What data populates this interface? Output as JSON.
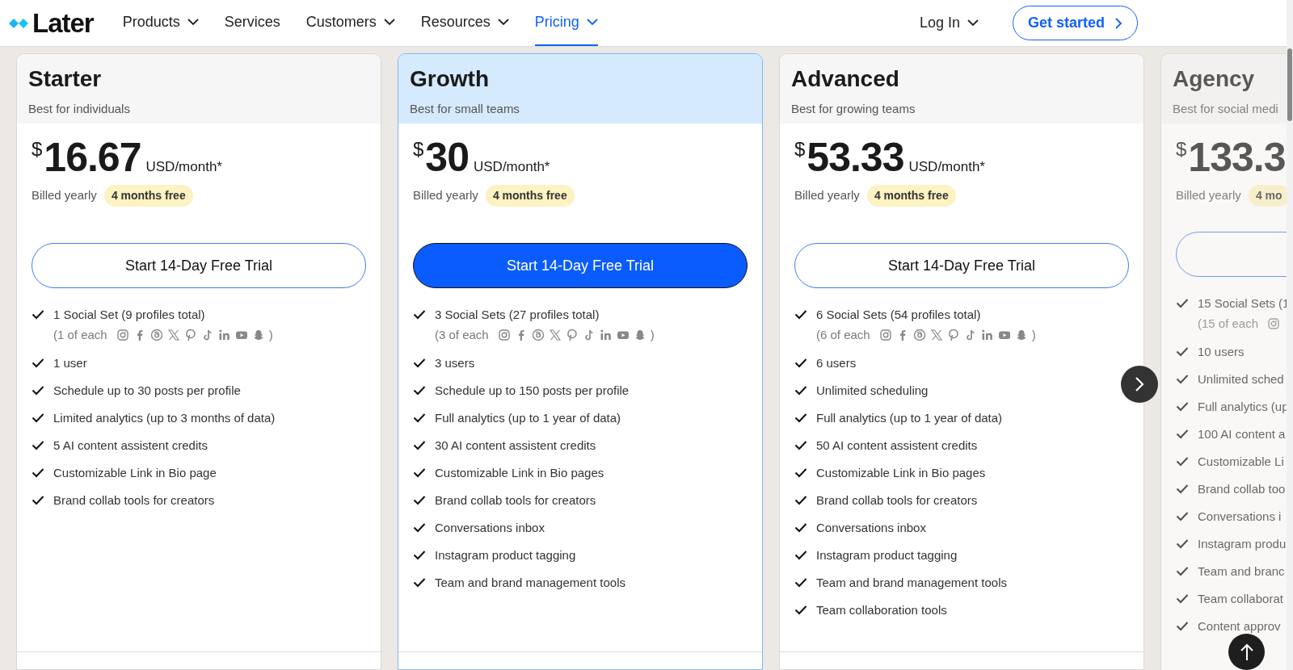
{
  "header": {
    "logo": "Later",
    "nav": [
      {
        "label": "Products",
        "caret": true,
        "selected": false
      },
      {
        "label": "Services",
        "caret": false,
        "selected": false
      },
      {
        "label": "Customers",
        "caret": true,
        "selected": false
      },
      {
        "label": "Resources",
        "caret": true,
        "selected": false
      },
      {
        "label": "Pricing",
        "caret": true,
        "selected": true
      }
    ],
    "login": "Log In",
    "cta": "Get started"
  },
  "plans": [
    {
      "name": "Starter",
      "tagline": "Best for individuals",
      "highlighted": false,
      "dimmed": false,
      "currency": "$",
      "price": "16.67",
      "unit": "USD/month*",
      "billing": "Billed yearly",
      "badge": "4 months free",
      "button": {
        "label": "Start 14-Day Free Trial",
        "kind": "outline"
      },
      "features": [
        {
          "text": "1 Social Set (9 profiles total)",
          "sub": {
            "prefix": "(1 of each",
            "icons": [
              {
                "kind": "instagram"
              },
              {
                "kind": "facebook"
              },
              {
                "kind": "threads"
              },
              {
                "kind": "x"
              },
              {
                "kind": "pinterest"
              },
              {
                "kind": "tiktok"
              },
              {
                "kind": "linkedin"
              },
              {
                "kind": "youtube"
              },
              {
                "kind": "snapchat"
              }
            ],
            "suffix": ")"
          }
        },
        {
          "text": "1 user"
        },
        {
          "text": "Schedule up to 30 posts per profile"
        },
        {
          "text": "Limited analytics (up to 3 months of data)"
        },
        {
          "text": "5 AI content assistent credits"
        },
        {
          "text": "Customizable Link in Bio page"
        },
        {
          "text": "Brand collab tools for creators"
        }
      ]
    },
    {
      "name": "Growth",
      "tagline": "Best for small teams",
      "highlighted": true,
      "dimmed": false,
      "currency": "$",
      "price": "30",
      "unit": "USD/month*",
      "billing": "Billed yearly",
      "badge": "4 months free",
      "button": {
        "label": "Start 14-Day Free Trial",
        "kind": "primary"
      },
      "features": [
        {
          "text": "3 Social Sets (27 profiles total)",
          "sub": {
            "prefix": "(3 of each",
            "icons": [
              {
                "kind": "instagram"
              },
              {
                "kind": "facebook"
              },
              {
                "kind": "threads"
              },
              {
                "kind": "x"
              },
              {
                "kind": "pinterest"
              },
              {
                "kind": "tiktok"
              },
              {
                "kind": "linkedin"
              },
              {
                "kind": "youtube"
              },
              {
                "kind": "snapchat"
              }
            ],
            "suffix": ")"
          }
        },
        {
          "text": "3 users"
        },
        {
          "text": "Schedule up to 150 posts per profile"
        },
        {
          "text": "Full analytics (up to 1 year of data)"
        },
        {
          "text": "30 AI content assistent credits"
        },
        {
          "text": "Customizable Link in Bio pages"
        },
        {
          "text": "Brand collab tools for creators"
        },
        {
          "text": "Conversations inbox"
        },
        {
          "text": "Instagram product tagging"
        },
        {
          "text": "Team and brand management tools"
        }
      ]
    },
    {
      "name": "Advanced",
      "tagline": "Best for growing teams",
      "highlighted": false,
      "dimmed": false,
      "currency": "$",
      "price": "53.33",
      "unit": "USD/month*",
      "billing": "Billed yearly",
      "badge": "4 months free",
      "button": {
        "label": "Start 14-Day Free Trial",
        "kind": "outline"
      },
      "features": [
        {
          "text": "6 Social Sets (54 profiles total)",
          "sub": {
            "prefix": "(6 of each",
            "icons": [
              {
                "kind": "instagram"
              },
              {
                "kind": "facebook"
              },
              {
                "kind": "threads"
              },
              {
                "kind": "x"
              },
              {
                "kind": "pinterest"
              },
              {
                "kind": "tiktok"
              },
              {
                "kind": "linkedin"
              },
              {
                "kind": "youtube"
              },
              {
                "kind": "snapchat"
              }
            ],
            "suffix": ")"
          }
        },
        {
          "text": "6 users"
        },
        {
          "text": "Unlimited scheduling"
        },
        {
          "text": "Full analytics (up to 1 year of data)"
        },
        {
          "text": "50 AI content assistent credits"
        },
        {
          "text": "Customizable Link in Bio pages"
        },
        {
          "text": "Brand collab tools for creators"
        },
        {
          "text": "Conversations inbox"
        },
        {
          "text": "Instagram product tagging"
        },
        {
          "text": "Team and brand management tools"
        },
        {
          "text": "Team collaboration tools"
        }
      ]
    },
    {
      "name": "Agency",
      "tagline": "Best for social medi",
      "highlighted": false,
      "dimmed": true,
      "currency": "$",
      "price": "133.3",
      "billing": "Billed yearly",
      "badge": "4 mo",
      "button": {
        "kind": "outline"
      },
      "features": [
        {
          "text": "15 Social Sets (1",
          "sub": {
            "prefix": "(15 of each",
            "icons": [
              {
                "kind": "instagram"
              }
            ]
          }
        },
        {
          "text": "10 users"
        },
        {
          "text": "Unlimited sched"
        },
        {
          "text": "Full analytics (up"
        },
        {
          "text": "100 AI content a"
        },
        {
          "text": "Customizable Li"
        },
        {
          "text": "Brand collab too"
        },
        {
          "text": "Conversations i"
        },
        {
          "text": "Instagram produ"
        },
        {
          "text": "Team and branc"
        },
        {
          "text": "Team collaborat"
        },
        {
          "text": "Content approv"
        }
      ]
    }
  ]
}
